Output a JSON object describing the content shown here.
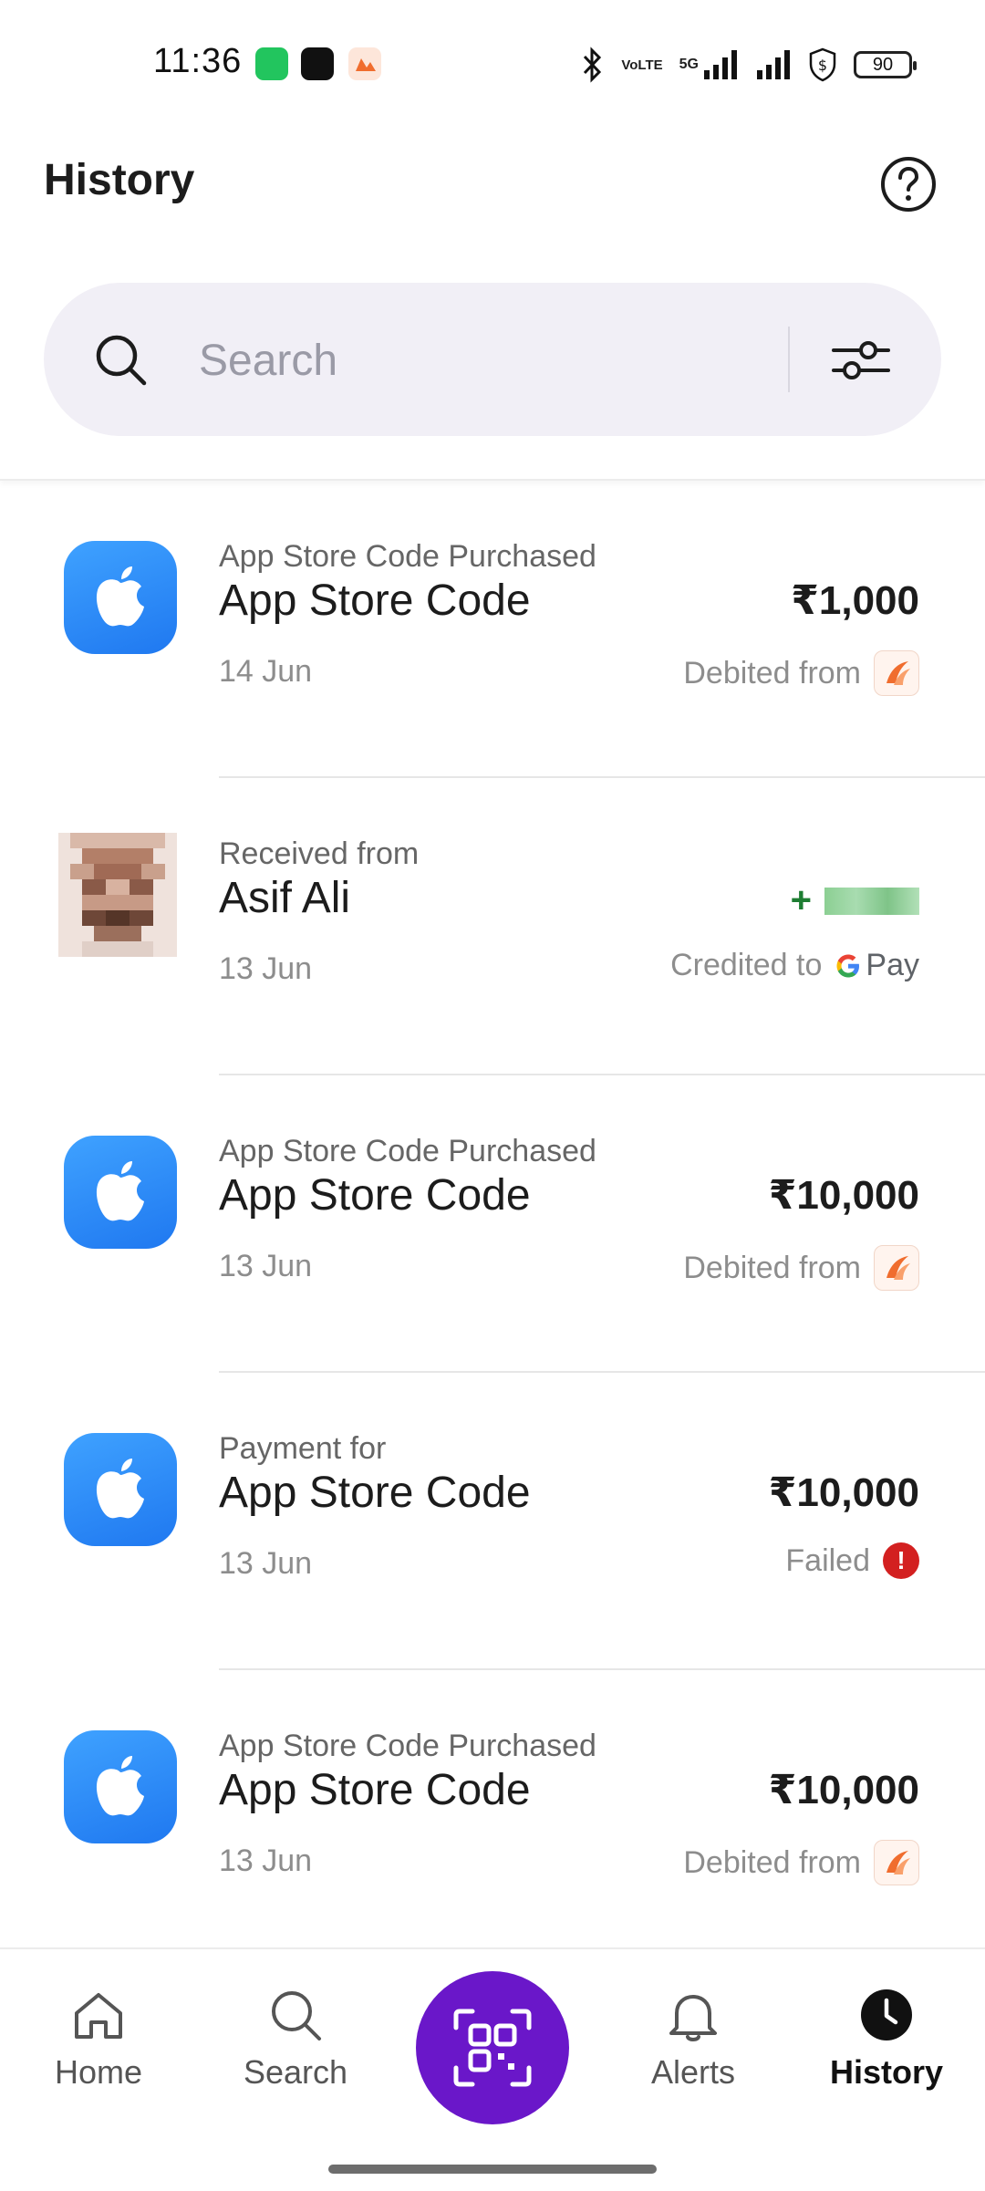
{
  "status_bar": {
    "time": "11:36",
    "network": "5G",
    "volte": "VoLTE",
    "battery": "90"
  },
  "header": {
    "title": "History",
    "help_icon": "help-circle-icon"
  },
  "search": {
    "placeholder": "Search",
    "value": "",
    "filter_icon": "sliders-icon"
  },
  "transactions": [
    {
      "type": "app-store",
      "subtitle": "App Store Code Purchased",
      "name": "App Store Code",
      "amount": "₹1,000",
      "date": "14 Jun",
      "status_text": "Debited from",
      "status_kind": "bank"
    },
    {
      "type": "person",
      "subtitle": "Received from",
      "name": "Asif Ali",
      "amount_prefix": "+",
      "date": "13 Jun",
      "status_text": "Credited to",
      "status_kind": "gpay",
      "gpay_label": "Pay"
    },
    {
      "type": "app-store",
      "subtitle": "App Store Code Purchased",
      "name": "App Store Code",
      "amount": "₹10,000",
      "date": "13 Jun",
      "status_text": "Debited from",
      "status_kind": "bank"
    },
    {
      "type": "app-store",
      "subtitle": "Payment for",
      "name": "App Store Code",
      "amount": "₹10,000",
      "date": "13 Jun",
      "status_text": "Failed",
      "status_kind": "failed",
      "fail_symbol": "!"
    },
    {
      "type": "app-store",
      "subtitle": "App Store Code Purchased",
      "name": "App Store Code",
      "amount": "₹10,000",
      "date": "13 Jun",
      "status_text": "Debited from",
      "status_kind": "bank"
    }
  ],
  "bottom_nav": {
    "items": [
      {
        "label": "Home",
        "icon": "home-icon"
      },
      {
        "label": "Search",
        "icon": "search-icon"
      },
      {
        "label": "",
        "icon": "qr-scan-icon"
      },
      {
        "label": "Alerts",
        "icon": "bell-icon"
      },
      {
        "label": "History",
        "icon": "clock-icon",
        "active": true
      }
    ]
  },
  "colors": {
    "accent": "#6a17c9",
    "credit": "#1e7d32",
    "failed": "#d32020",
    "app_icon": "#1f78f0"
  }
}
